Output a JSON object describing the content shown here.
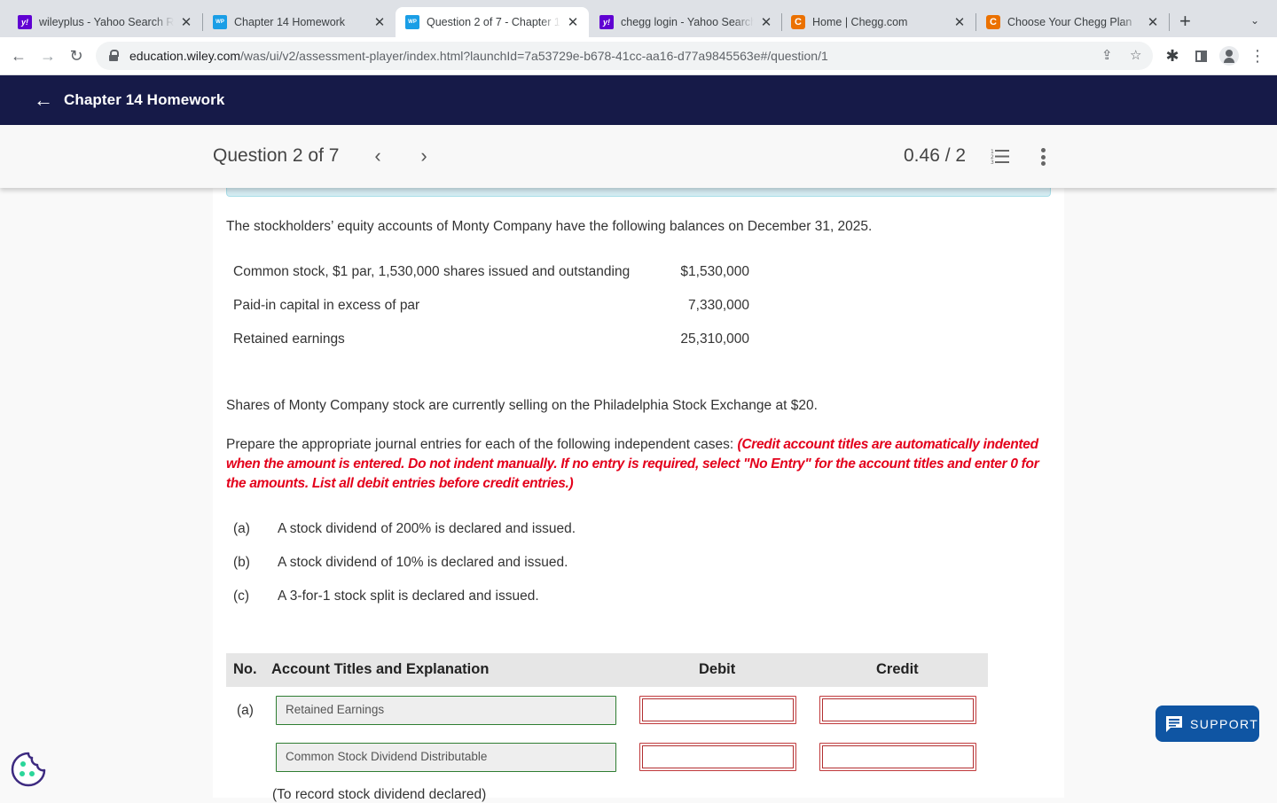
{
  "browser": {
    "tabs": [
      {
        "title": "wileyplus - Yahoo Search R",
        "favicon": "yahoo-icon",
        "active": false
      },
      {
        "title": "Chapter 14 Homework",
        "favicon": "wileyplus-icon",
        "active": false
      },
      {
        "title": "Question 2 of 7 - Chapter 1",
        "favicon": "wileyplus-icon",
        "active": true
      },
      {
        "title": "chegg login - Yahoo Search",
        "favicon": "yahoo-icon",
        "active": false
      },
      {
        "title": "Home | Chegg.com",
        "favicon": "chegg-icon",
        "active": false
      },
      {
        "title": "Choose Your Chegg Plan",
        "favicon": "chegg-icon",
        "active": false
      }
    ],
    "favicon_glyphs": {
      "yahoo": "y!",
      "wp": "WP",
      "chegg": "C"
    },
    "close_glyph": "✕",
    "new_tab_glyph": "+",
    "tab_menu_glyph": "⌄",
    "url_host": "education.wiley.com",
    "url_path": "/was/ui/v2/assessment-player/index.html?launchId=7a53729e-b678-41cc-aa16-d77a9845563e#/question/1",
    "nav": {
      "back": "←",
      "forward": "→",
      "reload": "↻"
    },
    "icons": {
      "share": "⇪",
      "star": "☆",
      "extensions": "✱",
      "menu": "⋮"
    }
  },
  "app": {
    "back_glyph": "←",
    "assignment_title": "Chapter 14 Homework",
    "question_label": "Question 2 of 7",
    "prev_glyph": "‹",
    "next_glyph": "›",
    "score": "0.46 / 2"
  },
  "question": {
    "intro": "The stockholders’ equity accounts of Monty Company have the following balances on December 31, 2025.",
    "balances": [
      {
        "label": "Common stock, $1 par, 1,530,000 shares issued and outstanding",
        "amount": "$1,530,000"
      },
      {
        "label": "Paid-in capital in excess of par",
        "amount": "7,330,000"
      },
      {
        "label": "Retained earnings",
        "amount": "25,310,000"
      }
    ],
    "market_note": "Shares of Monty Company stock are currently selling on the Philadelphia Stock Exchange at $20.",
    "instruction": "Prepare the appropriate journal entries for each of the following independent cases:",
    "instruction_red": "(Credit account titles are automatically indented when the amount is entered. Do not indent manually. If no entry is required, select \"No Entry\" for the account titles and enter 0 for the amounts. List all debit entries before credit entries.)",
    "cases": [
      {
        "label": "(a)",
        "text": "A stock dividend of 200% is declared and issued."
      },
      {
        "label": "(b)",
        "text": "A stock dividend of 10% is declared and issued."
      },
      {
        "label": "(c)",
        "text": "A 3-for-1 stock split is declared and issued."
      }
    ]
  },
  "journal": {
    "headers": {
      "no": "No.",
      "account": "Account Titles and Explanation",
      "debit": "Debit",
      "credit": "Credit"
    },
    "entries": [
      {
        "no": "(a)",
        "account": "Retained Earnings",
        "debit": "",
        "credit": ""
      },
      {
        "no": "",
        "account": "Common Stock Dividend Distributable",
        "debit": "",
        "credit": ""
      }
    ],
    "explanation": "(To record stock dividend declared)"
  },
  "widgets": {
    "support_label": "SUPPORT"
  },
  "colors": {
    "app_header": "#161a48",
    "instruction_red": "#e3001b",
    "account_border": "#2e7d32",
    "amount_border_error": "#c0393b",
    "support_button": "#0f55a3"
  }
}
